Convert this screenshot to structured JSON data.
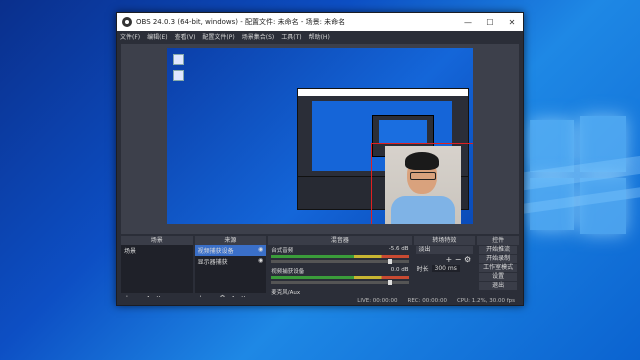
{
  "window": {
    "title": "OBS 24.0.3 (64-bit, windows) - 配置文件: 未命名 - 场景: 未命名",
    "minimize": "—",
    "maximize": "☐",
    "close": "✕"
  },
  "menu": [
    "文件(F)",
    "编辑(E)",
    "查看(V)",
    "配置文件(P)",
    "场景集合(S)",
    "工具(T)",
    "帮助(H)"
  ],
  "docks": {
    "scenes": {
      "header": "场景",
      "items": [
        "场景"
      ]
    },
    "sources": {
      "header": "来源",
      "items": [
        "视频捕获设备",
        "显示器捕获"
      ]
    },
    "mixer": {
      "header": "混音器",
      "tracks": [
        {
          "name": "台式音频",
          "db": "-5.6 dB"
        },
        {
          "name": "视频捕获设备",
          "db": "0.0 dB"
        },
        {
          "name": "麦克风/Aux",
          "db": ""
        }
      ]
    },
    "transitions": {
      "header": "转场特效",
      "selected": "淡出",
      "duration_label": "时长",
      "duration_value": "300 ms"
    },
    "controls": {
      "header": "控件",
      "buttons": [
        "开始推流",
        "开始录制",
        "工作室模式",
        "设置",
        "退出"
      ]
    }
  },
  "footer_icons": {
    "add": "+",
    "remove": "−",
    "up": "∧",
    "down": "∨",
    "gear": "⚙"
  },
  "status": {
    "live": "LIVE: 00:00:00",
    "rec": "REC: 00:00:00",
    "cpu": "CPU: 1.2%, 30.00 fps"
  }
}
